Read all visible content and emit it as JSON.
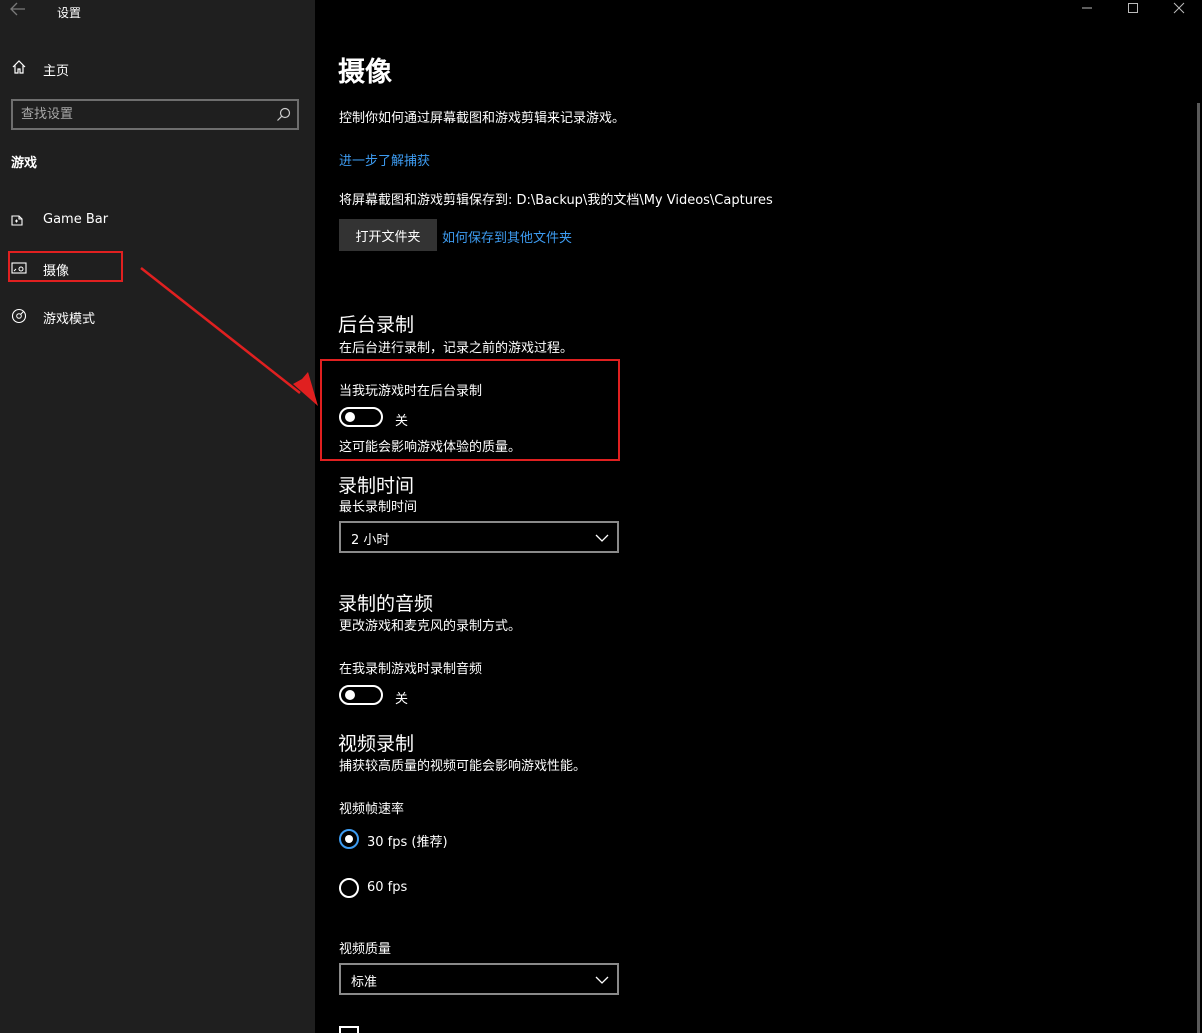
{
  "app": {
    "title": "设置"
  },
  "sidebar": {
    "home_label": "主页",
    "search_placeholder": "查找设置",
    "section": "游戏",
    "items": [
      {
        "label": "Game Bar",
        "icon": "gamebar-icon"
      },
      {
        "label": "摄像",
        "icon": "capture-icon"
      },
      {
        "label": "游戏模式",
        "icon": "gamemode-icon"
      }
    ]
  },
  "main": {
    "title": "摄像",
    "description": "控制你如何通过屏幕截图和游戏剪辑来记录游戏。",
    "learn_more_link": "进一步了解捕获",
    "save_path": "将屏幕截图和游戏剪辑保存到: D:\\Backup\\我的文档\\My Videos\\Captures",
    "open_folder_button": "打开文件夹",
    "save_elsewhere_link": "如何保存到其他文件夹",
    "background": {
      "heading": "后台录制",
      "description": "在后台进行录制，记录之前的游戏过程。",
      "toggle_label": "当我玩游戏时在后台录制",
      "toggle_state": "关",
      "note": "这可能会影响游戏体验的质量。"
    },
    "record_length": {
      "heading": "录制时间",
      "label": "最长录制时间",
      "value": "2 小时"
    },
    "audio": {
      "heading": "录制的音频",
      "description": "更改游戏和麦克风的录制方式。",
      "toggle_label": "在我录制游戏时录制音频",
      "toggle_state": "关"
    },
    "video": {
      "heading": "视频录制",
      "description": "捕获较高质量的视频可能会影响游戏性能。",
      "fps_label": "视频帧速率",
      "fps_options": [
        "30 fps (推荐)",
        "60 fps"
      ],
      "fps_selected": "30 fps (推荐)",
      "quality_label": "视频质量",
      "quality_value": "标准"
    }
  },
  "colors": {
    "accent": "#3d9bf0",
    "highlight": "#e02020",
    "sidebar_bg": "#1f1f1f"
  }
}
